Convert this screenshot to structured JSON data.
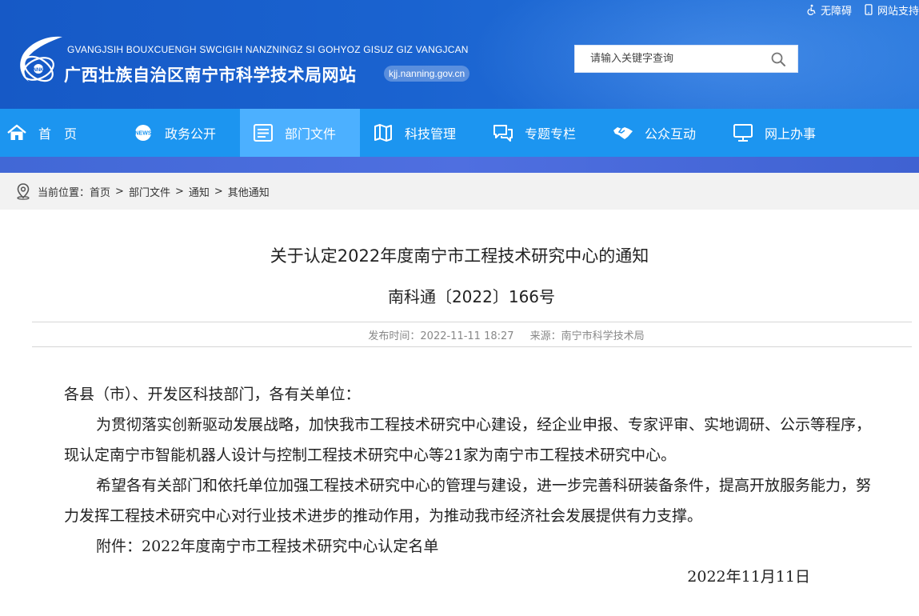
{
  "top_links": {
    "accessibility": "无障碍",
    "mobile_support": "网站支持"
  },
  "site": {
    "name_en": "GVANGJSIH BOUXCUENGH SWCIGIH NANZNINGZ SI GOHYOZ GISUZ GIZ VANGJCAN",
    "name_cn": "广西壮族自治区南宁市科学技术局网站",
    "domain": "kjj.nanning.gov.cn"
  },
  "search": {
    "placeholder": "请输入关键字查询"
  },
  "nav": {
    "items": [
      {
        "label": "首页",
        "icon": "home-icon"
      },
      {
        "label": "政务公开",
        "icon": "news-icon"
      },
      {
        "label": "部门文件",
        "icon": "document-list-icon",
        "active": true
      },
      {
        "label": "科技管理",
        "icon": "map-icon"
      },
      {
        "label": "专题专栏",
        "icon": "chat-icon"
      },
      {
        "label": "公众互动",
        "icon": "handshake-icon"
      },
      {
        "label": "网上办事",
        "icon": "monitor-icon"
      }
    ]
  },
  "breadcrumb": {
    "prefix": "当前位置：",
    "items": [
      "首页",
      "部门文件",
      "通知",
      "其他通知"
    ],
    "separator": ">"
  },
  "article": {
    "title": "关于认定2022年度南宁市工程技术研究中心的通知",
    "doc_number": "南科通〔2022〕166号",
    "publish_label": "发布时间：",
    "publish_time": "2022-11-11 18:27",
    "source_label": "来源：",
    "source": "南宁市科学技术局",
    "salutation": "各县（市）、开发区科技部门，各有关单位：",
    "paragraphs": [
      "为贯彻落实创新驱动发展战略，加快我市工程技术研究中心建设，经企业申报、专家评审、实地调研、公示等程序，现认定南宁市智能机器人设计与控制工程技术研究中心等21家为南宁市工程技术研究中心。",
      "希望各有关部门和依托单位加强工程技术研究中心的管理与建设，进一步完善科研装备条件，提高开放服务能力，努力发挥工程技术研究中心对行业技术进步的推动作用，为推动我市经济社会发展提供有力支撑。",
      "附件：2022年度南宁市工程技术研究中心认定名单"
    ],
    "date": "2022年11月11日"
  },
  "colors": {
    "header_blue": "#1a63d0",
    "nav_blue": "#1c95f0",
    "nav_active": "#4cb0ff",
    "nav_bottom": "#4a6cdc",
    "crumb_bg": "#f2f2f2"
  }
}
